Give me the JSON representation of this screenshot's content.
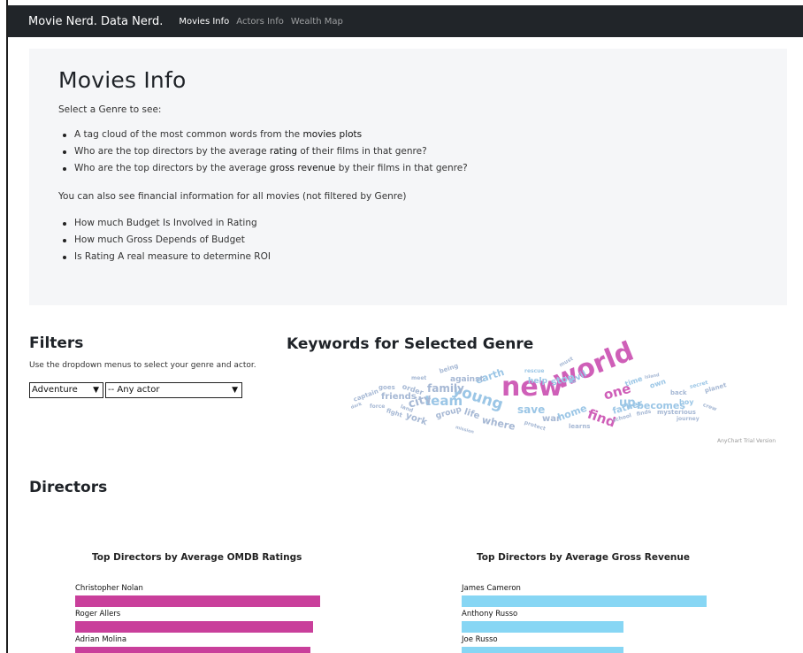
{
  "navbar": {
    "brand": "Movie Nerd. Data Nerd.",
    "links": [
      "Movies Info",
      "Actors Info",
      "Wealth Map"
    ],
    "active_link": "Movies Info"
  },
  "jumbotron": {
    "title": "Movies Info",
    "intro": "Select a Genre to see:",
    "genre_items": [
      {
        "before": "A tag cloud of the most common words from the ",
        "bold": "movies plots",
        "after": ""
      },
      {
        "before": "Who are the top directors by the average ",
        "bold": "rating",
        "after": " of their films in that genre?"
      },
      {
        "before": "Who are the top directors by the average ",
        "bold": "gross revenue",
        "after": " by their films in that genre?"
      }
    ],
    "also": "You can also see financial information for all movies (not filtered by Genre)",
    "financial_items": [
      "How much Budget Is Involved in Rating",
      "How much Gross Depends of Budget",
      "Is Rating A real measure to determine ROI"
    ]
  },
  "filters": {
    "title": "Filters",
    "help": "Use the dropdown menus to select your genre and actor.",
    "genre_selected": "Adventure",
    "actor_selected": "-- Any actor"
  },
  "keywords": {
    "title": "Keywords for Selected Genre",
    "trial_note": "AnyChart Trial Version",
    "words": [
      "new",
      "world",
      "young",
      "team",
      "family",
      "earth",
      "city",
      "save",
      "one",
      "find",
      "friends",
      "help",
      "stop",
      "evil",
      "against",
      "life",
      "where",
      "war",
      "home",
      "up",
      "becomes",
      "father",
      "group",
      "york",
      "goes",
      "order",
      "being",
      "meet",
      "captain",
      "fight",
      "time",
      "own",
      "back",
      "boy",
      "mysterious",
      "finds",
      "journey",
      "school",
      "learns",
      "protect",
      "rescue",
      "secret",
      "planet",
      "dark",
      "land",
      "mission",
      "force",
      "crew",
      "must",
      "island"
    ]
  },
  "directors": {
    "title": "Directors",
    "ratings_chart": {
      "title": "Top Directors by Average OMDB Ratings",
      "bars": [
        {
          "name": "Christopher Nolan",
          "value": 1.0
        },
        {
          "name": "Roger Allers",
          "value": 0.97
        },
        {
          "name": "Adrian Molina",
          "value": 0.96
        }
      ]
    },
    "gross_chart": {
      "title": "Top Directors by Average Gross Revenue",
      "bars": [
        {
          "name": "James Cameron",
          "value": 1.0
        },
        {
          "name": "Anthony Russo",
          "value": 0.66
        },
        {
          "name": "Joe Russo",
          "value": 0.66
        }
      ]
    }
  },
  "colors": {
    "navbar_bg": "#212529",
    "jumbotron_bg": "#f5f6f8",
    "ratings_bar": "#c93f9b",
    "gross_bar": "#87d6f4",
    "cloud_accent": "#cf5fb8",
    "cloud_main": "#9bc6e6"
  }
}
